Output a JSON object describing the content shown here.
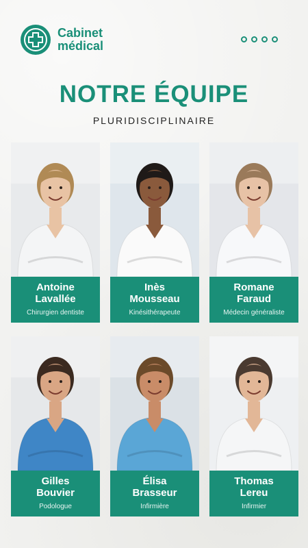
{
  "brand": {
    "line1": "Cabinet",
    "line2": "médical",
    "logo_icon": "medical-cross-hand-icon"
  },
  "menu": {
    "icon": "four-dots-menu-icon"
  },
  "title": "NOTRE ÉQUIPE",
  "subtitle": "PLURIDISCIPLINAIRE",
  "colors": {
    "accent": "#1a8f78",
    "background": "#f2f2f0"
  },
  "team": [
    {
      "first": "Antoine",
      "last": "Lavallée",
      "role": "Chirurgien dentiste",
      "scrub": "#f4f5f6",
      "skin": "#e8c3a4",
      "hair": "#b08a55",
      "bg": "#e8eaec"
    },
    {
      "first": "Inès",
      "last": "Mousseau",
      "role": "Kinésithérapeute",
      "scrub": "#fafafa",
      "skin": "#8a5a3c",
      "hair": "#1f1a18",
      "bg": "#dfe6ec"
    },
    {
      "first": "Romane",
      "last": "Faraud",
      "role": "Médecin généraliste",
      "scrub": "#f7f8fa",
      "skin": "#e7c2a6",
      "hair": "#9a7a5a",
      "bg": "#e4e6ea"
    },
    {
      "first": "Gilles",
      "last": "Bouvier",
      "role": "Podologue",
      "scrub": "#3f86c6",
      "skin": "#d9a684",
      "hair": "#3b2a20",
      "bg": "#e6e8ea"
    },
    {
      "first": "Élisa",
      "last": "Brasseur",
      "role": "Infirmière",
      "scrub": "#5aa6d6",
      "skin": "#c98c68",
      "hair": "#6b4a2a",
      "bg": "#dbe1e6"
    },
    {
      "first": "Thomas",
      "last": "Lereu",
      "role": "Infirmier",
      "scrub": "#f5f6f7",
      "skin": "#e2b797",
      "hair": "#4a3a30",
      "bg": "#eef0f2"
    }
  ]
}
